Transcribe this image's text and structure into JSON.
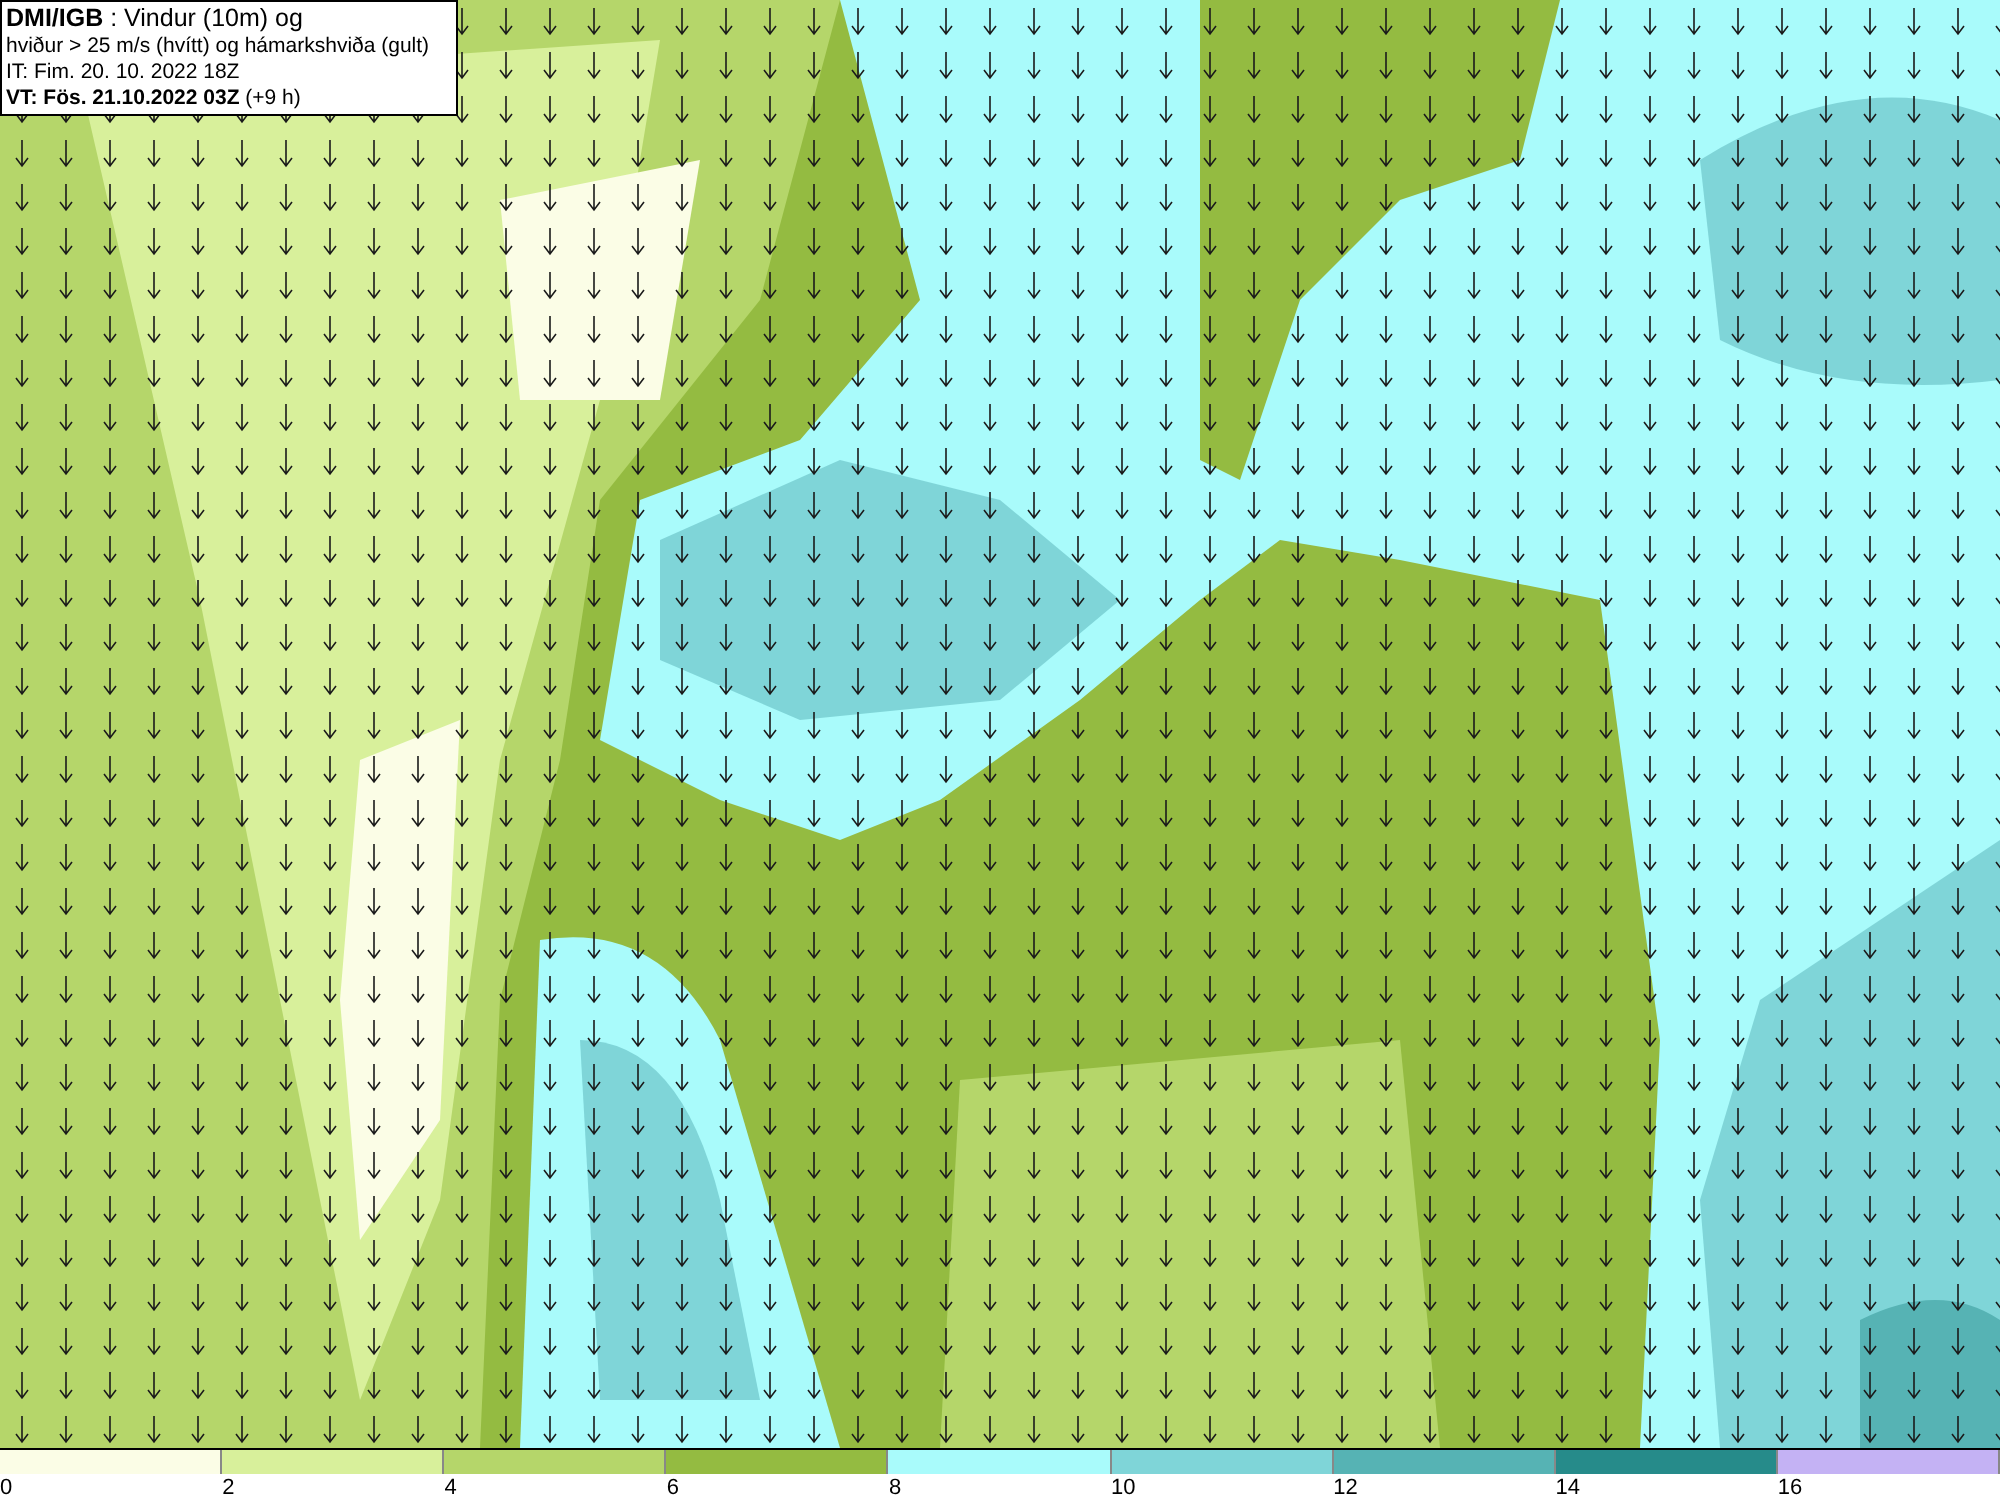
{
  "info_box": {
    "lines": [
      "**DMI/IGB** : Vindur (10m) og",
      "hviður > 25 m/s (hvítt) og hámarkshviða (gult)",
      "IT: Fim. 20. 10. 2022 18Z",
      "**VT: Fös. 21.10.2022 03Z** (+9 h)"
    ]
  },
  "legend": {
    "bins": [
      {
        "label": "0",
        "color": "#fbfde6"
      },
      {
        "label": "2",
        "color": "#d8f09b"
      },
      {
        "label": "4",
        "color": "#b5d66a"
      },
      {
        "label": "6",
        "color": "#94bb41"
      },
      {
        "label": "8",
        "color": "#a9fbfb"
      },
      {
        "label": "10",
        "color": "#7fd5d8"
      },
      {
        "label": "12",
        "color": "#56b3b4"
      },
      {
        "label": "14",
        "color": "#268b8a"
      },
      {
        "label": "16",
        "color": "#c4b2f4"
      }
    ]
  }
}
